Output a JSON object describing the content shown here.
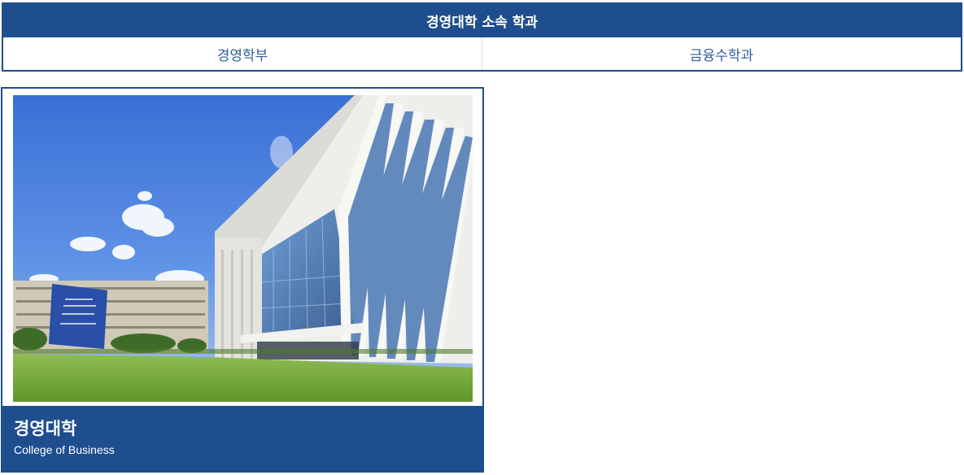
{
  "departments": {
    "title": "경영대학 소속 학과",
    "items": [
      {
        "label": "경영학부"
      },
      {
        "label": "금융수학과"
      }
    ]
  },
  "college": {
    "name": "경영대학",
    "subtitle": "College of Business"
  },
  "colors": {
    "primary": "#1f4e8f",
    "link": "#2d5f98"
  }
}
